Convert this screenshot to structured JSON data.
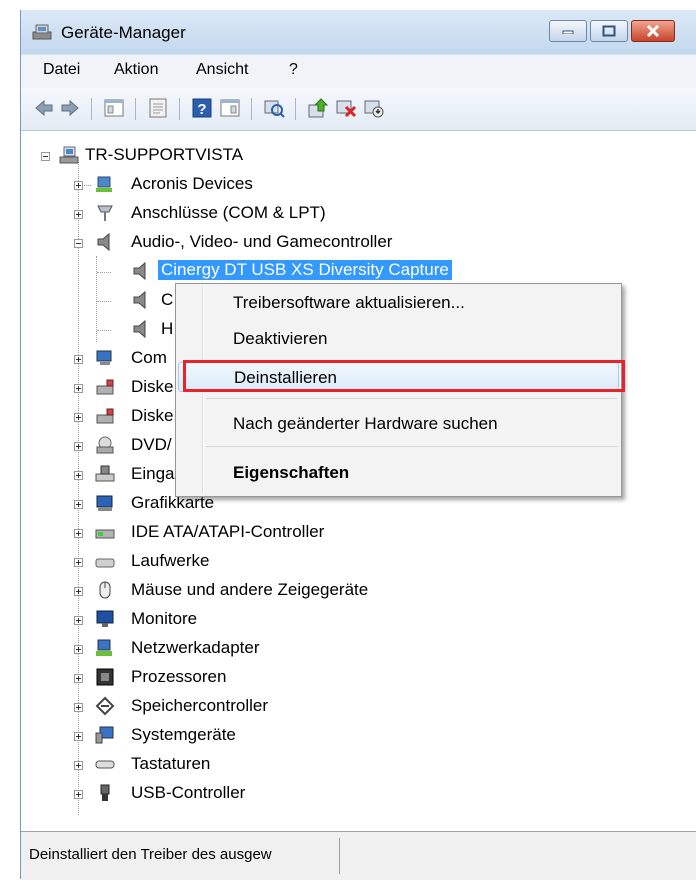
{
  "window": {
    "title": "Geräte-Manager",
    "controls": {
      "minimize": "minimize",
      "maximize": "maximize",
      "close": "close"
    }
  },
  "menu": [
    "Datei",
    "Aktion",
    "Ansicht",
    "?"
  ],
  "toolbar": {
    "icons": [
      "back-arrow-icon",
      "forward-arrow-icon",
      "properties-view-icon",
      "console-tree-icon",
      "help-icon",
      "details-view-icon",
      "scan-hardware-icon",
      "update-driver-icon",
      "disable-device-icon",
      "uninstall-device-icon"
    ]
  },
  "tree": {
    "root": "TR-SUPPORTVISTA",
    "categories": [
      {
        "label": "Acronis Devices",
        "icon": "network-device-icon"
      },
      {
        "label": "Anschlüsse (COM & LPT)",
        "icon": "port-icon"
      },
      {
        "label": "Audio-, Video- und Gamecontroller",
        "icon": "speaker-icon",
        "expanded": true,
        "children": [
          {
            "label": "Cinergy DT USB XS Diversity Capture",
            "selected": true
          },
          {
            "label": "C"
          },
          {
            "label": "H"
          }
        ]
      },
      {
        "label": "Com",
        "icon": "computer-icon"
      },
      {
        "label": "Diske",
        "icon": "disk-drive-icon"
      },
      {
        "label": "Diske",
        "icon": "disk-drive-icon"
      },
      {
        "label": "DVD/",
        "icon": "dvd-drive-icon"
      },
      {
        "label": "Einga",
        "icon": "keyboard-input-icon"
      },
      {
        "label": "Grafikkarte",
        "icon": "display-adapter-icon"
      },
      {
        "label": "IDE ATA/ATAPI-Controller",
        "icon": "ide-controller-icon"
      },
      {
        "label": "Laufwerke",
        "icon": "drive-icon"
      },
      {
        "label": "Mäuse und andere Zeigegeräte",
        "icon": "mouse-icon"
      },
      {
        "label": "Monitore",
        "icon": "monitor-icon"
      },
      {
        "label": "Netzwerkadapter",
        "icon": "network-adapter-icon"
      },
      {
        "label": "Prozessoren",
        "icon": "processor-icon"
      },
      {
        "label": "Speichercontroller",
        "icon": "storage-controller-icon"
      },
      {
        "label": "Systemgeräte",
        "icon": "system-device-icon"
      },
      {
        "label": "Tastaturen",
        "icon": "keyboard-icon"
      },
      {
        "label": "USB-Controller",
        "icon": "usb-icon"
      }
    ]
  },
  "context_menu": {
    "items": [
      {
        "label": "Treibersoftware aktualisieren..."
      },
      {
        "label": "Deaktivieren"
      },
      {
        "label": "Deinstallieren",
        "highlighted": true
      },
      {
        "label": "Nach geänderter Hardware suchen"
      },
      {
        "label": "Eigenschaften",
        "bold": true
      }
    ]
  },
  "status_bar": {
    "text": "Deinstalliert den Treiber des ausgew"
  },
  "colors": {
    "selection": "#3399ff",
    "highlight_box": "#e8232a"
  }
}
